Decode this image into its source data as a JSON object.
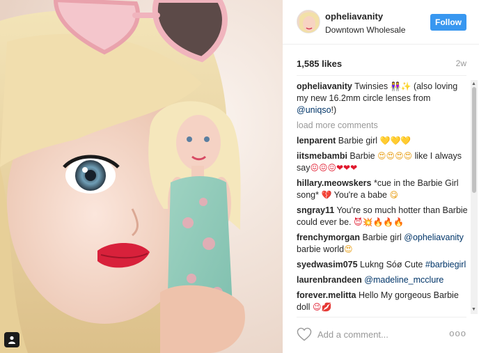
{
  "post": {
    "username": "opheliavanity",
    "location": "Downtown Wholesale",
    "follow_label": "Follow",
    "likes": "1,585 likes",
    "age": "2w"
  },
  "caption": {
    "user": "opheliavanity",
    "text": "Twinsies",
    "emoji": "👭✨",
    "text2": "(also loving my new 16.2mm circle lenses from",
    "mention": "@uniqso",
    "tail": "!)"
  },
  "load_more": "load more comments",
  "comments": [
    {
      "user": "lenparent",
      "text": "Barbie girl",
      "emoji": "💛💛💛"
    },
    {
      "user": "iitsmebambi",
      "text": "Barbie",
      "emoji1": "😍😍😍😍",
      "text2": "like I always say",
      "emoji2": "😖😖😖❤❤❤"
    },
    {
      "user": "hillary.meowskers",
      "text": "*cue in the Barbie Girl song*",
      "emoji": "💔",
      "text2": "You're a babe",
      "emoji2": "😋"
    },
    {
      "user": "sngray11",
      "text": "You're so much hotter than Barbie could ever be.",
      "emoji": "😈💥🔥🔥🔥"
    },
    {
      "user": "frenchymorgan",
      "text": "Barbie girl",
      "mention": "@opheliavanity",
      "text2": "barbie world",
      "emoji": "😍"
    },
    {
      "user": "syedwasim075",
      "text": "Lukng Sóø Cute",
      "hashtag": "#barbiegirl"
    },
    {
      "user": "laurenbrandeen",
      "mention": "@madeline_mcclure"
    },
    {
      "user": "forever.melitta",
      "text": "Hello My gorgeous Barbie doll",
      "emoji": "😉💋"
    }
  ],
  "footer": {
    "placeholder": "Add a comment...",
    "more": "ooo"
  },
  "icons": {
    "like": "heart-outline-icon",
    "more": "more-options-icon",
    "tag": "user-tag-icon"
  },
  "colors": {
    "follow_button": "#3897f0",
    "mention": "#003569",
    "muted": "#999999"
  }
}
